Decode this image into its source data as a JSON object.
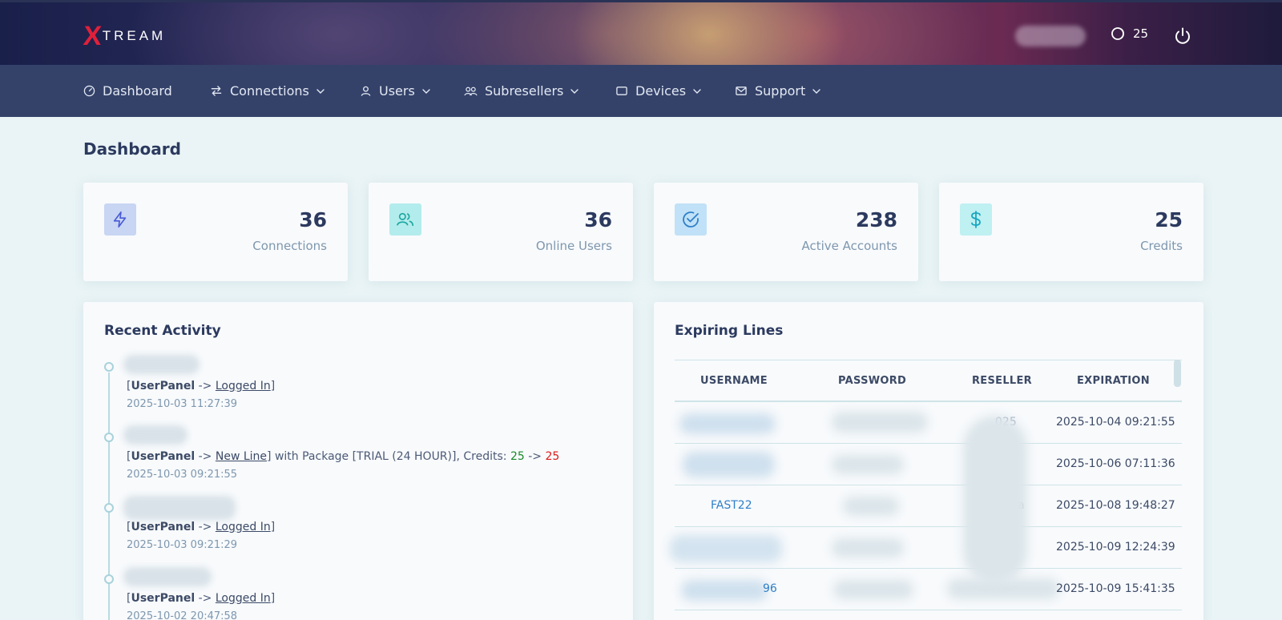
{
  "brand": {
    "logo_x": "X",
    "logo_rest": "TREAM"
  },
  "header": {
    "credits_value": "25"
  },
  "nav": {
    "items": [
      {
        "label": "Dashboard"
      },
      {
        "label": "Connections"
      },
      {
        "label": "Users"
      },
      {
        "label": "Subresellers"
      },
      {
        "label": "Devices"
      },
      {
        "label": "Support"
      }
    ]
  },
  "page": {
    "title": "Dashboard"
  },
  "stats": [
    {
      "value": "36",
      "label": "Connections",
      "icon": "lightning-icon",
      "color": "#c8d5f3"
    },
    {
      "value": "36",
      "label": "Online Users",
      "icon": "users-icon",
      "color": "#b3ecec"
    },
    {
      "value": "238",
      "label": "Active Accounts",
      "icon": "check-circle-icon",
      "color": "#c0e1f7"
    },
    {
      "value": "25",
      "label": "Credits",
      "icon": "dollar-icon",
      "color": "#bff0f2"
    }
  ],
  "activity": {
    "title": "Recent Activity",
    "items": [
      {
        "source": "UserPanel",
        "arrow": "->",
        "action": "Logged In",
        "date": "2025-10-03 11:27:39"
      },
      {
        "source": "UserPanel",
        "arrow": "->",
        "action": "New Line",
        "suffix": "] with Package [TRIAL (24 HOUR)], Credits: ",
        "credits_from": "25",
        "credits_arrow": " -> ",
        "credits_to": "25",
        "date": "2025-10-03 09:21:55"
      },
      {
        "source": "UserPanel",
        "arrow": "->",
        "action": "Logged In",
        "date": "2025-10-03 09:21:29"
      },
      {
        "source": "UserPanel",
        "arrow": "->",
        "action": "Logged In",
        "date": "2025-10-02 20:47:58"
      }
    ]
  },
  "expiring": {
    "title": "Expiring Lines",
    "columns": [
      "USERNAME",
      "PASSWORD",
      "RESELLER",
      "EXPIRATION"
    ],
    "rows": [
      {
        "username": "",
        "reseller": "025",
        "expiration": "2025-10-04 09:21:55"
      },
      {
        "username": "",
        "reseller": "",
        "expiration": "2025-10-06 07:11:36"
      },
      {
        "username": "FAST22",
        "reseller": "a",
        "expiration": "2025-10-08 19:48:27"
      },
      {
        "username": "",
        "reseller": "",
        "expiration": "2025-10-09 12:24:39"
      },
      {
        "username": "96",
        "reseller": "",
        "expiration": "2025-10-09 15:41:35"
      }
    ]
  },
  "colors": {
    "accent": "#2f7fc8",
    "nav_bg": "#34426a",
    "credits_green": "#1b8a2a",
    "credits_red": "#e01919"
  }
}
